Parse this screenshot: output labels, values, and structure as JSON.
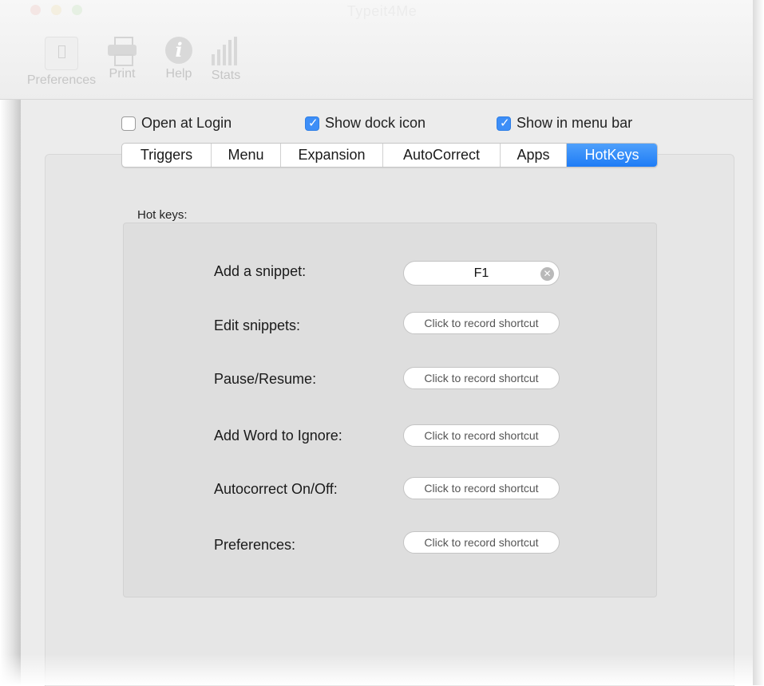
{
  "window": {
    "title": "Typeit4Me"
  },
  "toolbar": {
    "items": [
      {
        "label": "Preferences",
        "icon": "preferences-icon"
      },
      {
        "label": "Print",
        "icon": "printer-icon"
      },
      {
        "label": "Help",
        "icon": "info-icon"
      },
      {
        "label": "Stats",
        "icon": "bar-chart-icon"
      }
    ]
  },
  "options": [
    {
      "label": "Open at Login",
      "checked": false
    },
    {
      "label": "Show dock icon",
      "checked": true
    },
    {
      "label": "Show in menu bar",
      "checked": true
    }
  ],
  "tabs": [
    {
      "label": "Triggers",
      "active": false
    },
    {
      "label": "Menu",
      "active": false
    },
    {
      "label": "Expansion",
      "active": false
    },
    {
      "label": "AutoCorrect",
      "active": false
    },
    {
      "label": "Apps",
      "active": false
    },
    {
      "label": "HotKeys",
      "active": true
    }
  ],
  "hotkeys": {
    "group_label": "Hot keys:",
    "rows": [
      {
        "label": "Add a snippet:",
        "value": "F1"
      },
      {
        "label": "Edit snippets:",
        "placeholder": "Click to record shortcut"
      },
      {
        "label": "Pause/Resume:",
        "placeholder": "Click to record shortcut"
      },
      {
        "label": "Add Word to Ignore:",
        "placeholder": "Click to record shortcut"
      },
      {
        "label": "Autocorrect On/Off:",
        "placeholder": "Click to record shortcut"
      },
      {
        "label": "Preferences:",
        "placeholder": "Click to record shortcut"
      }
    ]
  },
  "colors": {
    "accent": "#1e7cf6",
    "checkbox_on": "#3d8ef7"
  }
}
